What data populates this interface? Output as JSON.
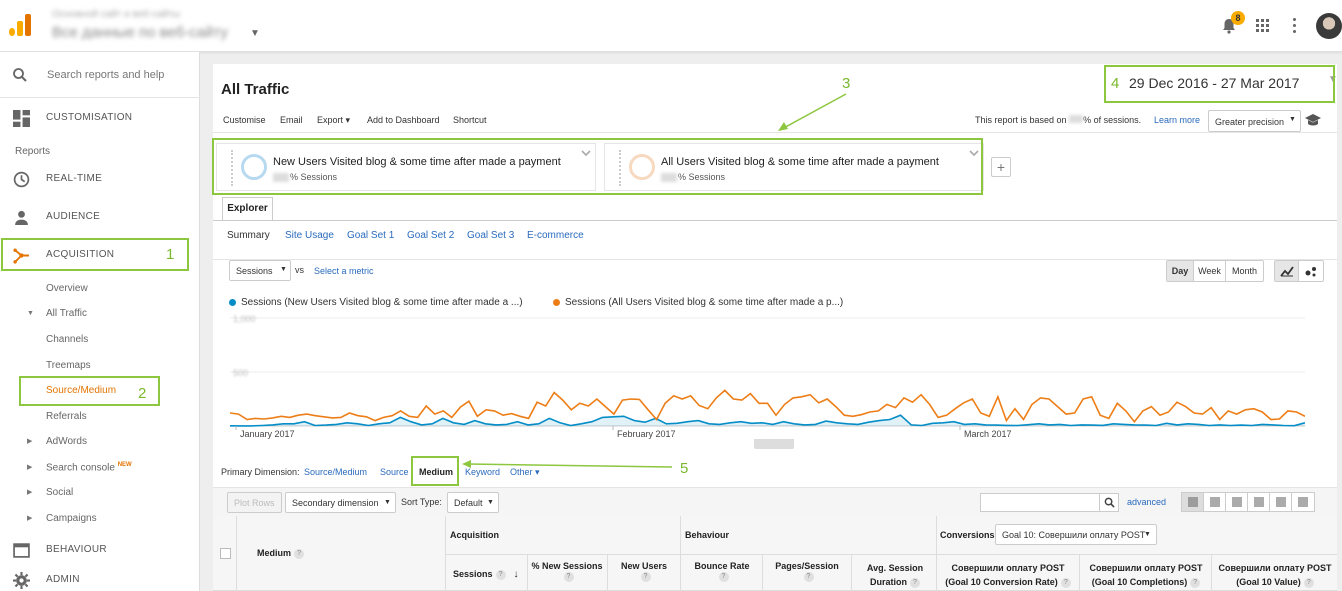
{
  "topbar": {
    "account_path": "Основной сайт и веб-сайты",
    "account_view": "Все данные по веб-сайту",
    "notification_count": "8"
  },
  "sidebar": {
    "search_placeholder": "Search reports and help",
    "customisation": "CUSTOMISATION",
    "reports_caption": "Reports",
    "realtime": "REAL-TIME",
    "audience": "AUDIENCE",
    "acquisition": "ACQUISITION",
    "acq_items": [
      "Overview",
      "All Traffic",
      "Channels",
      "Treemaps",
      "Source/Medium",
      "Referrals",
      "AdWords",
      "Search console",
      "Social",
      "Campaigns"
    ],
    "new_badge": "NEW",
    "behaviour": "BEHAVIOUR",
    "admin": "ADMIN"
  },
  "annotations": [
    "1",
    "2",
    "3",
    "4",
    "5"
  ],
  "report": {
    "title": "All Traffic",
    "date_range": "29 Dec 2016 - 27 Mar 2017",
    "toolbar": [
      "Customise",
      "Email",
      "Export",
      "Add to Dashboard",
      "Shortcut"
    ],
    "sampling_prefix": "This report is based on",
    "sampling_suffix": "% of sessions.",
    "learn_more": "Learn more",
    "precision": "Greater precision"
  },
  "segments": [
    {
      "name": "New Users Visited blog & some time after made a payment",
      "suffix": "% Sessions",
      "color": "#b6d9f0"
    },
    {
      "name": "All Users Visited blog & some time after made a payment",
      "suffix": "% Sessions",
      "color": "#f7d9bf"
    }
  ],
  "explorer_tab": "Explorer",
  "subtabs": [
    "Summary",
    "Site Usage",
    "Goal Set 1",
    "Goal Set 2",
    "Goal Set 3",
    "E-commerce"
  ],
  "metric": {
    "selected": "Sessions",
    "vs": "vs",
    "select": "Select a metric"
  },
  "granularity": [
    "Day",
    "Week",
    "Month"
  ],
  "chart_data": {
    "type": "line",
    "series": [
      {
        "name": "Sessions (New Users Visited blog & some time after made a ...)",
        "color": "#058dc7",
        "values": [
          2,
          1,
          1,
          5,
          10,
          20,
          20,
          40,
          5,
          8,
          15,
          30,
          20,
          5,
          20,
          30,
          80,
          40,
          10,
          20,
          70,
          30,
          15,
          50,
          20,
          10,
          15,
          40,
          10,
          20,
          70,
          30,
          5,
          20,
          40,
          80,
          85,
          90,
          50,
          35,
          70,
          20,
          25,
          40,
          50,
          20,
          15,
          30,
          40,
          25,
          30,
          15,
          40,
          20,
          10,
          15,
          45,
          30,
          20,
          15,
          35,
          50,
          60,
          100,
          10,
          5,
          25,
          30,
          40,
          15,
          20,
          10,
          8,
          6,
          5,
          12,
          20,
          10,
          15,
          5,
          10,
          8,
          6,
          20,
          15,
          10,
          8,
          5,
          25,
          10,
          20,
          15,
          5,
          10,
          5,
          8,
          5,
          15,
          10,
          5,
          3,
          30
        ]
      },
      {
        "name": "Sessions (All Users Visited blog & some time after made a p...)",
        "color": "#ed7e17",
        "values": [
          120,
          110,
          60,
          70,
          65,
          75,
          90,
          80,
          100,
          110,
          95,
          85,
          75,
          80,
          120,
          95,
          85,
          50,
          80,
          95,
          140,
          90,
          80,
          185,
          110,
          140,
          80,
          175,
          230,
          90,
          150,
          140,
          100,
          115,
          90,
          70,
          220,
          185,
          310,
          240,
          150,
          210,
          185,
          250,
          180,
          110,
          240,
          250,
          245,
          150,
          60,
          210,
          280,
          250,
          280,
          190,
          160,
          260,
          330,
          250,
          240,
          300,
          210,
          210,
          100,
          200,
          260,
          270,
          290,
          215,
          250,
          180,
          100,
          90,
          105,
          130,
          140,
          200,
          170,
          260,
          220,
          290,
          200,
          80,
          100,
          160,
          215,
          250,
          120,
          90,
          270,
          50,
          160,
          60,
          200,
          260,
          250,
          180,
          110,
          120,
          250,
          270,
          100,
          70,
          210,
          140,
          40,
          140,
          180,
          100,
          130,
          220,
          180,
          120,
          110,
          170,
          60,
          140,
          110,
          150,
          160,
          130,
          60,
          65,
          140,
          130,
          90
        ]
      }
    ],
    "x_ticks": [
      "January 2017",
      "February 2017",
      "March 2017"
    ],
    "y_ticks": [
      "1,000",
      "500"
    ],
    "ylim": [
      0,
      1000
    ]
  },
  "primary_dimension": {
    "label": "Primary Dimension:",
    "options": [
      "Source/Medium",
      "Source",
      "Medium",
      "Keyword",
      "Other"
    ]
  },
  "table_controls": {
    "plot_rows": "Plot Rows",
    "secondary": "Secondary dimension",
    "sort_label": "Sort Type:",
    "sort_value": "Default",
    "advanced": "advanced"
  },
  "table_header": {
    "medium": "Medium",
    "acquisition": "Acquisition",
    "behaviour": "Behaviour",
    "conversions": "Conversions",
    "goal_select": "Goal 10: Совершили оплату POST",
    "cols": [
      "Sessions",
      "% New Sessions",
      "New Users",
      "Bounce Rate",
      "Pages/Session",
      "Avg. Session Duration",
      "Совершили оплату POST (Goal 10 Conversion Rate)",
      "Совершили оплату POST (Goal 10 Completions)",
      "Совершили оплату POST (Goal 10 Value)"
    ]
  }
}
